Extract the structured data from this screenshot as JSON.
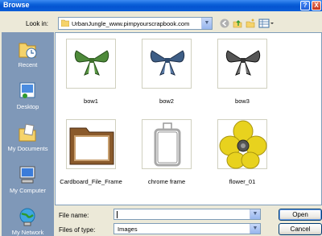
{
  "window": {
    "title": "Browse",
    "help_glyph": "?",
    "close_glyph": "X"
  },
  "toolbar": {
    "lookin_label": "Look in:",
    "lookin_value": "UrbanJungle_www.pimpyourscrapbook.com",
    "icons": [
      "back-icon",
      "up-folder-icon",
      "new-folder-icon",
      "view-menu-icon"
    ]
  },
  "places": [
    {
      "label": "Recent",
      "icon": "recent-icon"
    },
    {
      "label": "Desktop",
      "icon": "desktop-icon"
    },
    {
      "label": "My Documents",
      "icon": "my-documents-icon"
    },
    {
      "label": "My Computer",
      "icon": "my-computer-icon"
    },
    {
      "label": "My Network",
      "icon": "my-network-icon"
    }
  ],
  "files": [
    {
      "name": "bow1",
      "color": "#4E8A3A"
    },
    {
      "name": "bow2",
      "color": "#3E5E86"
    },
    {
      "name": "bow3",
      "color": "#333333"
    },
    {
      "name": "Cardboard_File_Frame",
      "color": "#8A5A2B"
    },
    {
      "name": "chrome frame",
      "color": "#A8A8A8"
    },
    {
      "name": "flower_01",
      "color": "#E8D21E"
    }
  ],
  "form": {
    "filename_label": "File name:",
    "filename_value": "",
    "filetype_label": "Files of type:",
    "filetype_value": "Images",
    "open_label": "Open",
    "cancel_label": "Cancel"
  }
}
